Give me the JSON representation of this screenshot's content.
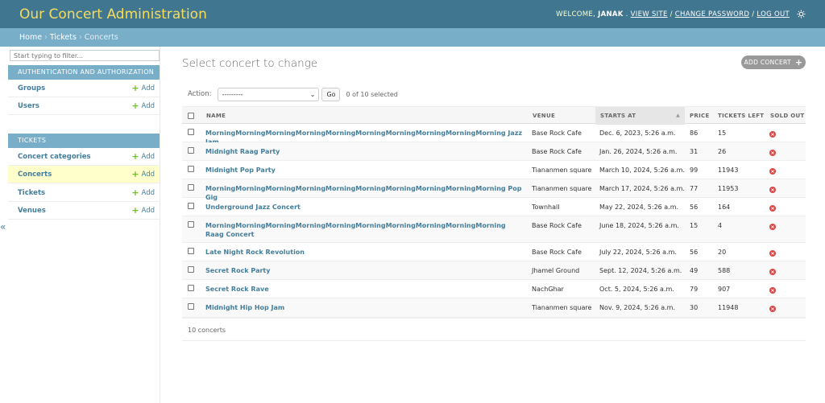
{
  "header": {
    "site_name": "Our Concert Administration",
    "welcome": "WELCOME,",
    "user": "JANAK",
    "view_site": "VIEW SITE",
    "change_password": "CHANGE PASSWORD",
    "log_out": "LOG OUT",
    "sep": "/"
  },
  "breadcrumbs": {
    "home": "Home",
    "app": "Tickets",
    "current": "Concerts",
    "sep": "›"
  },
  "sidebar": {
    "filter_placeholder": "Start typing to filter...",
    "collapse": "«",
    "add_label": "Add",
    "apps": [
      {
        "caption": "AUTHENTICATION AND AUTHORIZATION",
        "models": [
          {
            "name": "Groups"
          },
          {
            "name": "Users"
          }
        ]
      },
      {
        "caption": "TICKETS",
        "models": [
          {
            "name": "Concert categories"
          },
          {
            "name": "Concerts"
          },
          {
            "name": "Tickets"
          },
          {
            "name": "Venues"
          }
        ]
      }
    ]
  },
  "content": {
    "title": "Select concert to change",
    "add_button": "ADD CONCERT",
    "action_label": "Action:",
    "action_selected": "---------",
    "go": "Go",
    "counter": "0 of 10 selected",
    "columns": {
      "name": "NAME",
      "venue": "VENUE",
      "starts_at": "STARTS AT",
      "price": "PRICE",
      "tickets_left": "TICKETS LEFT",
      "sold_out": "SOLD OUT"
    },
    "rows": [
      {
        "name": "MorningMorningMorningMorningMorningMorningMorningMorningMorningMorning Jazz Jam",
        "venue": "Base Rock Cafe",
        "starts_at": "Dec. 6, 2023, 5:26 a.m.",
        "price": "86",
        "tickets_left": "15"
      },
      {
        "name": "Midnight Raag Party",
        "venue": "Base Rock Cafe",
        "starts_at": "Jan. 26, 2024, 5:26 a.m.",
        "price": "31",
        "tickets_left": "26"
      },
      {
        "name": "Midnight Pop Party",
        "venue": "Tiananmen square",
        "starts_at": "March 10, 2024, 5:26 a.m.",
        "price": "99",
        "tickets_left": "11943"
      },
      {
        "name": "MorningMorningMorningMorningMorningMorningMorningMorningMorningMorning Pop Gig",
        "venue": "Tiananmen square",
        "starts_at": "March 17, 2024, 5:26 a.m.",
        "price": "77",
        "tickets_left": "11953"
      },
      {
        "name": "Underground Jazz Concert",
        "venue": "Townhall",
        "starts_at": "May 22, 2024, 5:26 a.m.",
        "price": "56",
        "tickets_left": "164"
      },
      {
        "name": "MorningMorningMorningMorningMorningMorningMorningMorningMorningMorning Raag Concert",
        "venue": "Base Rock Cafe",
        "starts_at": "June 18, 2024, 5:26 a.m.",
        "price": "15",
        "tickets_left": "4"
      },
      {
        "name": "Late Night Rock Revolution",
        "venue": "Base Rock Cafe",
        "starts_at": "July 22, 2024, 5:26 a.m.",
        "price": "56",
        "tickets_left": "20"
      },
      {
        "name": "Secret Rock Party",
        "venue": "Jhamel Ground",
        "starts_at": "Sept. 12, 2024, 5:26 a.m.",
        "price": "49",
        "tickets_left": "588"
      },
      {
        "name": "Secret Rock Rave",
        "venue": "NachGhar",
        "starts_at": "Oct. 5, 2024, 5:26 a.m.",
        "price": "79",
        "tickets_left": "907"
      },
      {
        "name": "Midnight Hip Hop Jam",
        "venue": "Tiananmen square",
        "starts_at": "Nov. 9, 2024, 5:26 a.m.",
        "price": "30",
        "tickets_left": "11948"
      }
    ],
    "paginator": "10 concerts"
  }
}
